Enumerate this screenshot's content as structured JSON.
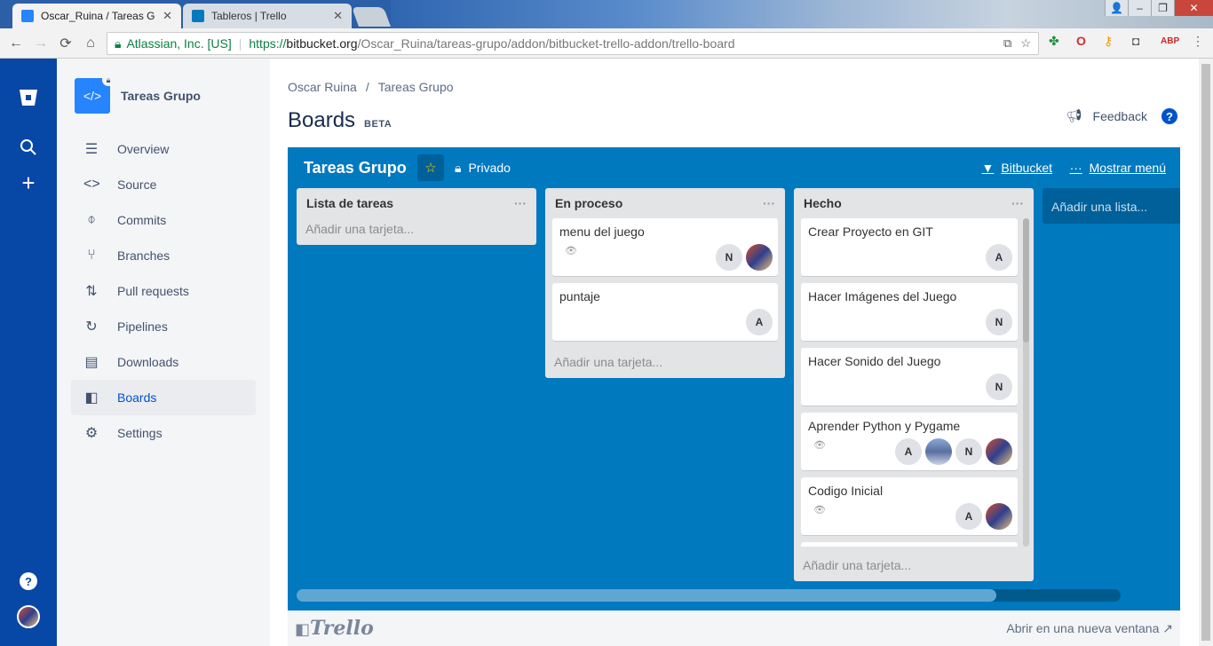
{
  "browser": {
    "tabs": [
      {
        "title": "Oscar_Ruina / Tareas Gru",
        "close": "✕",
        "favicon_color": "#2684ff"
      },
      {
        "title": "Tableros | Trello",
        "close": "✕",
        "favicon_color": "#0079bf"
      }
    ],
    "window_controls": {
      "minimize": "–",
      "maximize": "❐",
      "close": "✕",
      "user": "👤"
    },
    "nav": {
      "back": "←",
      "forward": "→",
      "reload": "⟳",
      "home": "⌂"
    },
    "address": {
      "secure_org": "Atlassian, Inc. [US]",
      "scheme": "https://",
      "host": "bitbucket.org",
      "path": "/Oscar_Ruina/tareas-grupo/addon/bitbucket-trello-addon/trello-board"
    },
    "extensions": [
      "translate-icon",
      "star-icon",
      "puzzle-icon",
      "opera-icon",
      "key-icon",
      "bag-icon",
      "adblock-icon",
      "more-icon"
    ]
  },
  "global_nav": {
    "logo": "bitbucket-logo",
    "search": "search-icon",
    "create": "+",
    "help": "?"
  },
  "sidebar": {
    "repo_name": "Tareas Grupo",
    "repo_icon": "</>",
    "items": [
      {
        "label": "Overview",
        "icon": "☰"
      },
      {
        "label": "Source",
        "icon": "<>"
      },
      {
        "label": "Commits",
        "icon": "⌽"
      },
      {
        "label": "Branches",
        "icon": "⑂"
      },
      {
        "label": "Pull requests",
        "icon": "⇅"
      },
      {
        "label": "Pipelines",
        "icon": "↻"
      },
      {
        "label": "Downloads",
        "icon": "▤"
      },
      {
        "label": "Boards",
        "icon": "◧",
        "active": true
      },
      {
        "label": "Settings",
        "icon": "⚙"
      }
    ]
  },
  "main": {
    "breadcrumb": [
      "Oscar Ruina",
      "/",
      "Tareas Grupo"
    ],
    "title": "Boards",
    "badge": "BETA",
    "feedback": "Feedback",
    "help": "?"
  },
  "board": {
    "title": "Tareas Grupo",
    "star": "☆",
    "privacy": "Privado",
    "bitbucket_link": "Bitbucket",
    "show_menu": "Mostrar menú",
    "add_list": "Añadir una lista...",
    "lists": [
      {
        "name": "Lista de tareas",
        "menu": "···",
        "add_card": "Añadir una tarjeta...",
        "cards": []
      },
      {
        "name": "En proceso",
        "menu": "···",
        "add_card": "Añadir una tarjeta...",
        "cards": [
          {
            "title": "menu del juego",
            "watch": true,
            "members": [
              "N",
              "img"
            ]
          },
          {
            "title": "puntaje",
            "watch": false,
            "members": [
              "A"
            ]
          }
        ]
      },
      {
        "name": "Hecho",
        "menu": "···",
        "add_card": "Añadir una tarjeta...",
        "cards": [
          {
            "title": "Crear Proyecto en GIT",
            "watch": false,
            "members": [
              "A"
            ]
          },
          {
            "title": "Hacer Imágenes del Juego",
            "watch": false,
            "members": [
              "N"
            ]
          },
          {
            "title": "Hacer Sonido del Juego",
            "watch": false,
            "members": [
              "N"
            ]
          },
          {
            "title": "Aprender Python y Pygame",
            "watch": true,
            "members": [
              "A",
              "mtn",
              "N",
              "img"
            ]
          },
          {
            "title": "Codigo Inicial",
            "watch": true,
            "members": [
              "A",
              "img"
            ]
          }
        ]
      }
    ]
  },
  "footer": {
    "logo": "Trello",
    "open_new": "Abrir en una nueva ventana",
    "open_icon": "↗"
  }
}
